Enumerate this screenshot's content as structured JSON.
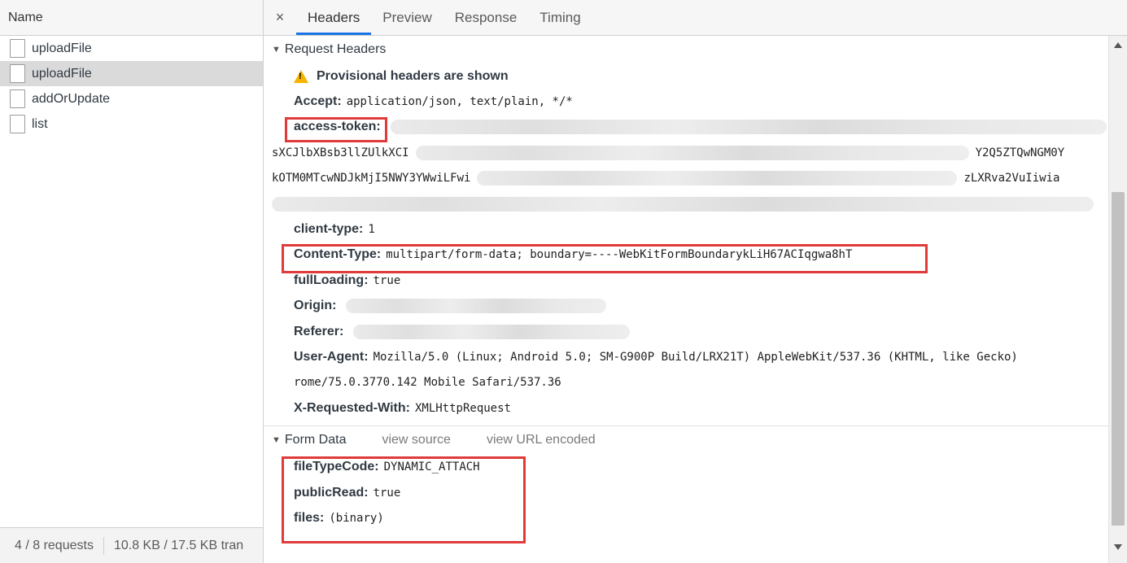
{
  "left": {
    "header": "Name",
    "requests": [
      "uploadFile",
      "uploadFile",
      "addOrUpdate",
      "list"
    ],
    "footer_count": "4 / 8 requests",
    "footer_size": "10.8 KB / 17.5 KB tran"
  },
  "tabs": {
    "close": "×",
    "items": [
      "Headers",
      "Preview",
      "Response",
      "Timing"
    ],
    "active": "Headers"
  },
  "request_headers": {
    "title": "Request Headers",
    "warning": "Provisional headers are shown",
    "accept_key": "Accept:",
    "accept_val": "application/json, text/plain, */*",
    "token_key": "access-token:",
    "token_line2_start": "sXCJlbXBsb3llZUlkXCI",
    "token_line2_end": "Y2Q5ZTQwNGM0Y",
    "token_line3_start": "kOTM0MTcwNDJkMjI5NWY3YWwiLFwi",
    "token_line3_end": "zLXRva2VuIiwia",
    "client_type_key": "client-type:",
    "client_type_val": "1",
    "content_type_key": "Content-Type:",
    "content_type_val": "multipart/form-data; boundary=----WebKitFormBoundarykLiH67ACIqgwa8hT",
    "full_loading_key": "fullLoading:",
    "full_loading_val": "true",
    "origin_key": "Origin:",
    "referer_key": "Referer:",
    "ua_key": "User-Agent:",
    "ua_val": "Mozilla/5.0 (Linux; Android 5.0; SM-G900P Build/LRX21T) AppleWebKit/537.36 (KHTML, like Gecko)",
    "ua_val2": "rome/75.0.3770.142 Mobile Safari/537.36",
    "xrw_key": "X-Requested-With:",
    "xrw_val": "XMLHttpRequest"
  },
  "form_data": {
    "title": "Form Data",
    "view_source": "view source",
    "view_url_encoded": "view URL encoded",
    "file_type_key": "fileTypeCode:",
    "file_type_val": "DYNAMIC_ATTACH",
    "public_read_key": "publicRead:",
    "public_read_val": "true",
    "files_key": "files:",
    "files_val": "(binary)"
  },
  "colors": {
    "highlight_box": "#e03a3a",
    "active_tab_underline": "#1a73e8",
    "warning": "#f5b400"
  }
}
